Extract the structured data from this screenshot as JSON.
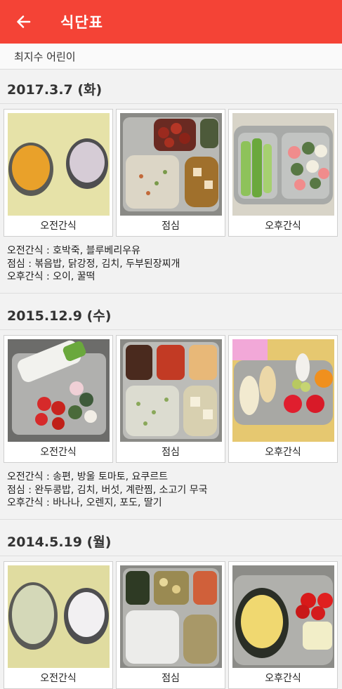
{
  "appbar": {
    "title": "식단표",
    "back_icon": "arrow-left-icon"
  },
  "child": {
    "name": "최지수 어린이"
  },
  "days": [
    {
      "date": "2017.3.7 (화)",
      "meals": [
        {
          "label": "오전간식",
          "photo": "snack-photo"
        },
        {
          "label": "점심",
          "photo": "lunch-photo"
        },
        {
          "label": "오후간식",
          "photo": "snack-photo"
        }
      ],
      "menu": [
        "오전간식 : 호박죽, 블루베리우유",
        "점심 : 볶음밥, 닭강정, 김치, 두부된장찌개",
        "오후간식 : 오이, 꿀떡"
      ]
    },
    {
      "date": "2015.12.9 (수)",
      "meals": [
        {
          "label": "오전간식",
          "photo": "snack-photo"
        },
        {
          "label": "점심",
          "photo": "lunch-photo"
        },
        {
          "label": "오후간식",
          "photo": "snack-photo"
        }
      ],
      "menu": [
        "오전간식 : 송편, 방울 토마토, 요쿠르트",
        "점심 : 완두콩밥, 김치, 버섯, 계란찜, 소고기 무국",
        "오후간식 : 바나나, 오렌지, 포도, 딸기"
      ]
    },
    {
      "date": "2014.5.19 (월)",
      "meals": [
        {
          "label": "오전간식",
          "photo": "snack-photo"
        },
        {
          "label": "점심",
          "photo": "lunch-photo"
        },
        {
          "label": "오후간식",
          "photo": "snack-photo"
        }
      ]
    }
  ],
  "colors": {
    "appbar": "#f44336",
    "background": "#f2f2f2"
  }
}
